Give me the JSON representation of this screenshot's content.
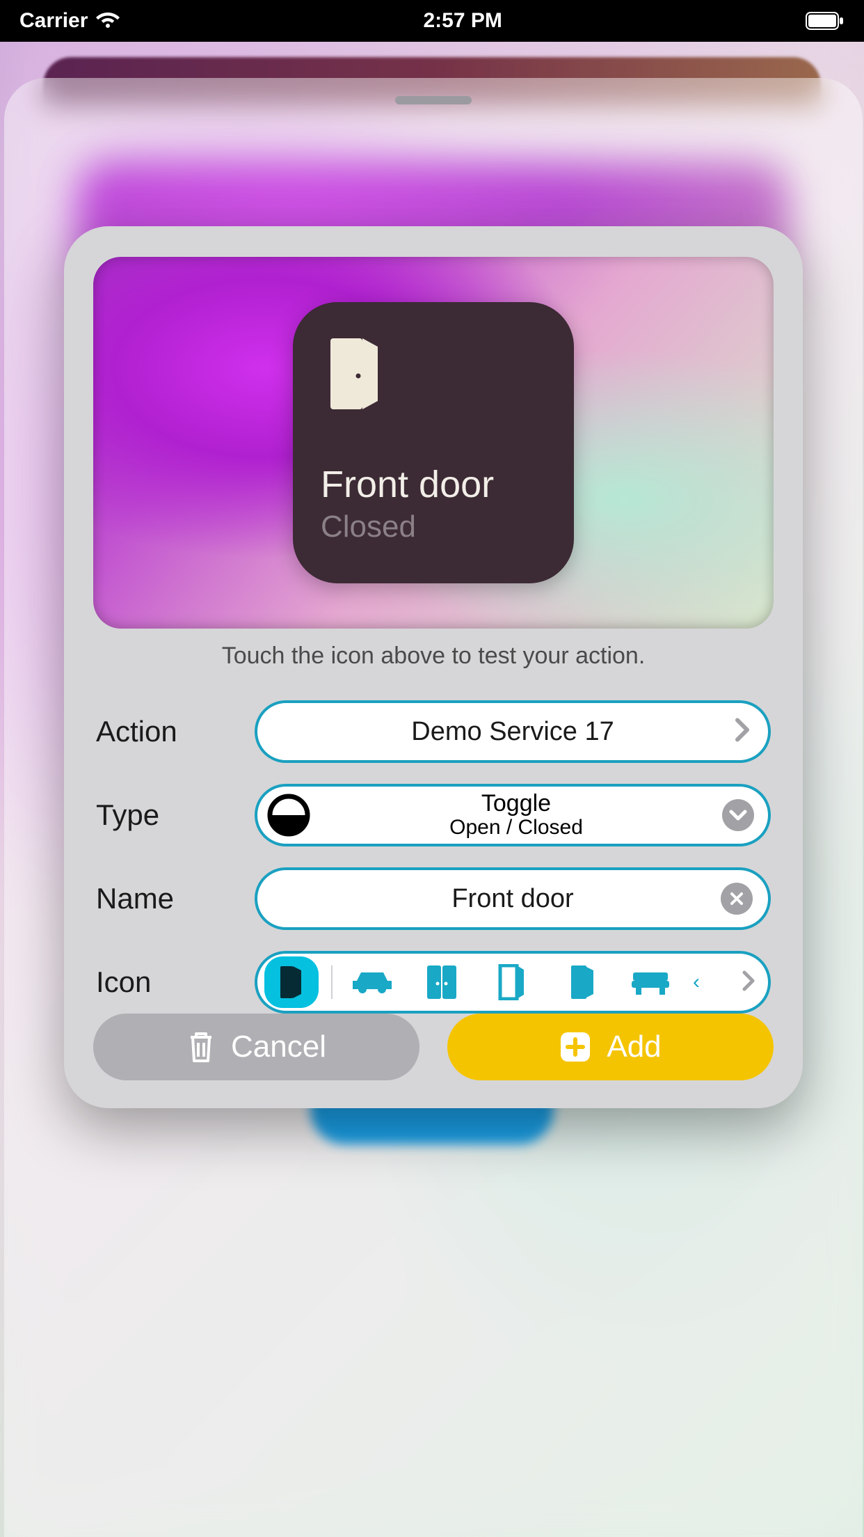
{
  "statusbar": {
    "carrier": "Carrier",
    "time": "2:57 PM"
  },
  "preview": {
    "title": "Front door",
    "subtitle": "Closed",
    "hint": "Touch the icon above to test your action."
  },
  "form": {
    "action": {
      "label": "Action",
      "value": "Demo Service 17"
    },
    "type": {
      "label": "Type",
      "main": "Toggle",
      "sub": "Open / Closed"
    },
    "name": {
      "label": "Name",
      "value": "Front door"
    },
    "icon": {
      "label": "Icon",
      "options": [
        "door-closed",
        "car",
        "double-door",
        "door-open",
        "door-ajar",
        "bench"
      ],
      "selected": "door-closed"
    }
  },
  "buttons": {
    "cancel": "Cancel",
    "add": "Add"
  }
}
